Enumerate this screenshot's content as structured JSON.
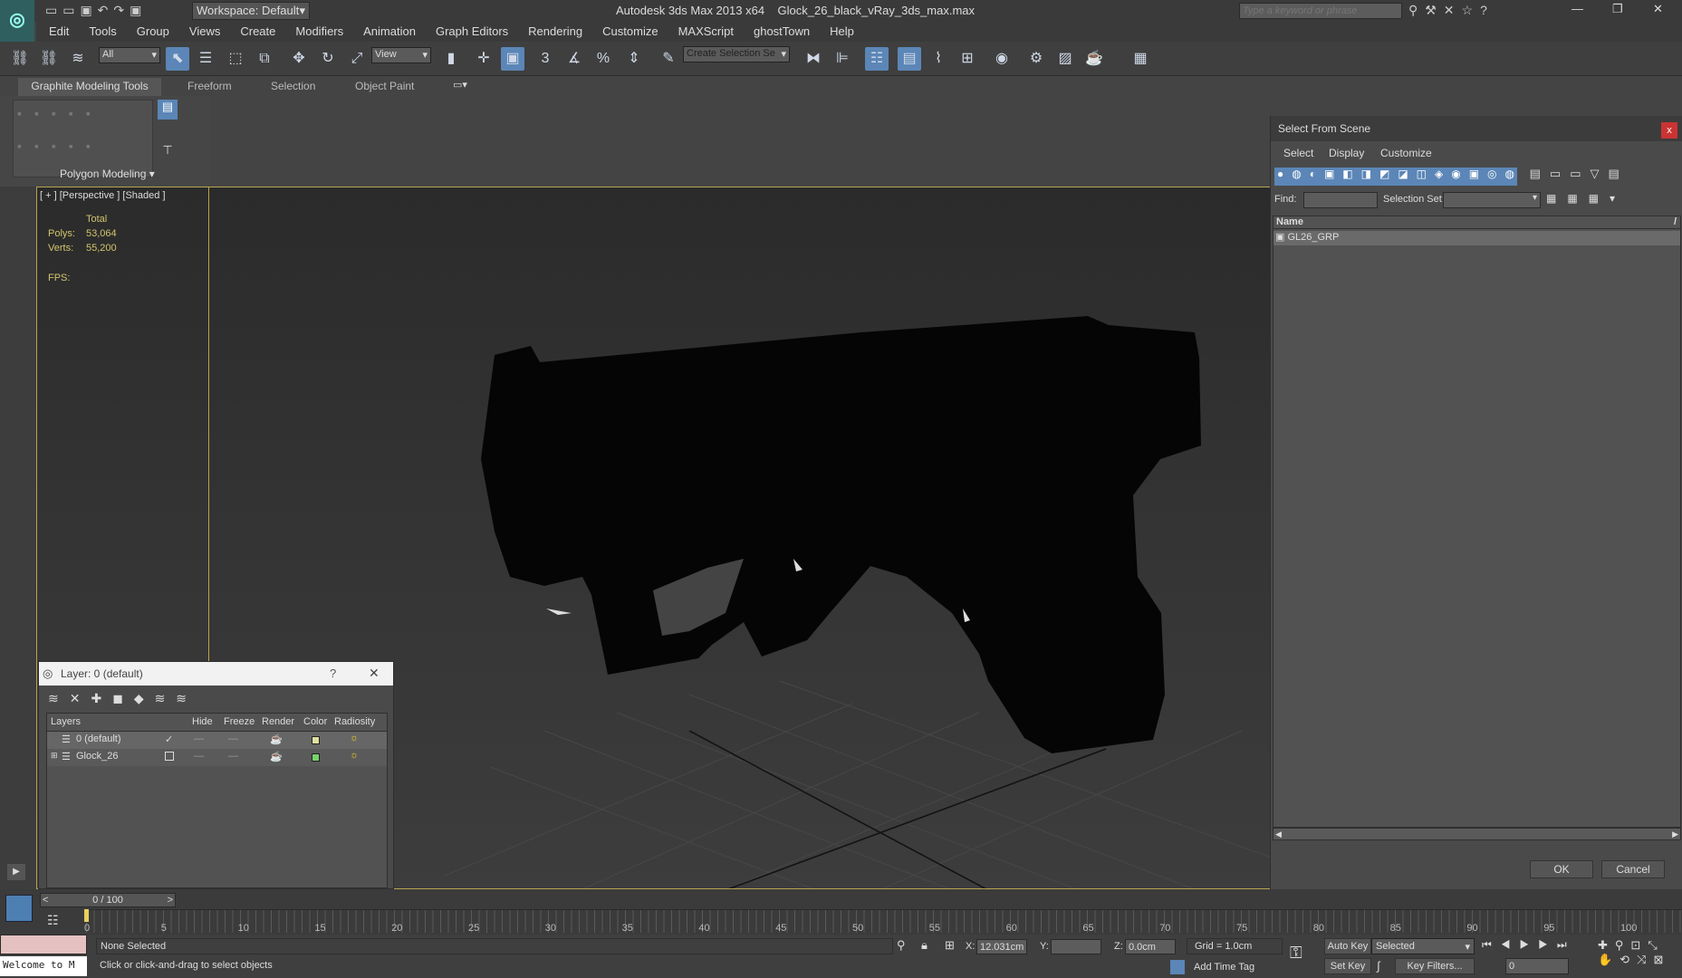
{
  "app": {
    "title": "Autodesk 3ds Max  2013 x64",
    "file": "Glock_26_black_vRay_3ds_max.max",
    "workspace": "Workspace: Default",
    "search_placeholder": "Type a keyword or phrase"
  },
  "menu": [
    "Edit",
    "Tools",
    "Group",
    "Views",
    "Create",
    "Modifiers",
    "Animation",
    "Graph Editors",
    "Rendering",
    "Customize",
    "MAXScript",
    "ghostTown",
    "Help"
  ],
  "toolbar": {
    "filter": "All",
    "ref_coord": "View",
    "selection_set": "Create Selection Se",
    "snap_label": "3"
  },
  "ribbon": {
    "tabs": [
      "Graphite Modeling Tools",
      "Freeform",
      "Selection",
      "Object Paint"
    ],
    "panel_label": "Polygon Modeling"
  },
  "viewport": {
    "label": "[ + ] [Perspective ] [Shaded ]",
    "stats_header": "Total",
    "polys_label": "Polys:",
    "polys": "53,064",
    "verts_label": "Verts:",
    "verts": "55,200",
    "fps_label": "FPS:"
  },
  "sfs": {
    "title": "Select From Scene",
    "menus": [
      "Select",
      "Display",
      "Customize"
    ],
    "find_label": "Find:",
    "selset_label": "Selection Set:",
    "col_name": "Name",
    "items": [
      "GL26_GRP"
    ],
    "ok": "OK",
    "cancel": "Cancel"
  },
  "layer": {
    "title": "Layer: 0 (default)",
    "help": "?",
    "cols": [
      "Layers",
      "Hide",
      "Freeze",
      "Render",
      "Color",
      "Radiosity"
    ],
    "rows": [
      {
        "name": "0 (default)",
        "color": "#e0e0a0"
      },
      {
        "name": "Glock_26",
        "color": "#77d26a"
      }
    ]
  },
  "timeline": {
    "frame": "0 / 100",
    "ticks": [
      "0",
      "5",
      "10",
      "15",
      "20",
      "25",
      "30",
      "35",
      "40",
      "45",
      "50",
      "55",
      "60",
      "65",
      "70",
      "75",
      "80",
      "85",
      "90",
      "95",
      "100"
    ]
  },
  "status": {
    "maxscript": "Welcome to M",
    "selected": "None Selected",
    "prompt": "Click or click-and-drag to select objects",
    "x_label": "X:",
    "x": "12.031cm",
    "y_label": "Y:",
    "y": "",
    "z_label": "Z:",
    "z": "0.0cm",
    "grid": "Grid = 1.0cm",
    "addtime": "Add Time Tag",
    "autokey": "Auto Key",
    "setkey": "Set Key",
    "keymode": "Selected",
    "keyfilters": "Key Filters...",
    "curframe": "0"
  }
}
